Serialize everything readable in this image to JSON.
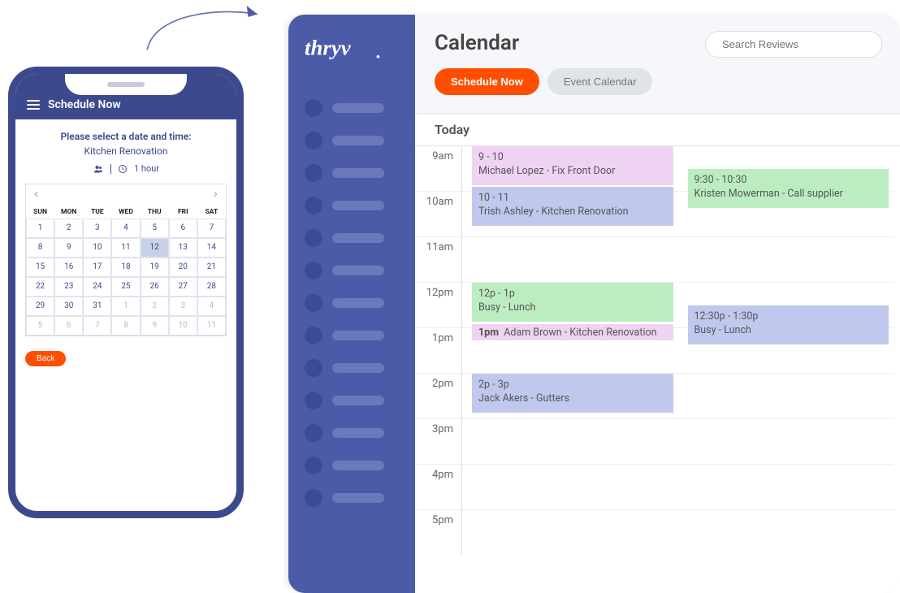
{
  "phone": {
    "header_title": "Schedule Now",
    "prompt_line1": "Please select a date and time:",
    "prompt_line2": "Kitchen Renovation",
    "duration_label": "1 hour",
    "day_headers": [
      "SUN",
      "MON",
      "TUE",
      "WED",
      "THU",
      "FRI",
      "SAT"
    ],
    "weeks": [
      [
        {
          "d": "1"
        },
        {
          "d": "2"
        },
        {
          "d": "3"
        },
        {
          "d": "4"
        },
        {
          "d": "5"
        },
        {
          "d": "6"
        },
        {
          "d": "7"
        }
      ],
      [
        {
          "d": "8"
        },
        {
          "d": "9"
        },
        {
          "d": "10"
        },
        {
          "d": "11"
        },
        {
          "d": "12",
          "sel": true
        },
        {
          "d": "13"
        },
        {
          "d": "14"
        }
      ],
      [
        {
          "d": "15"
        },
        {
          "d": "16"
        },
        {
          "d": "17"
        },
        {
          "d": "18"
        },
        {
          "d": "19"
        },
        {
          "d": "20"
        },
        {
          "d": "21"
        }
      ],
      [
        {
          "d": "22"
        },
        {
          "d": "23"
        },
        {
          "d": "24"
        },
        {
          "d": "25"
        },
        {
          "d": "26"
        },
        {
          "d": "27"
        },
        {
          "d": "28"
        }
      ],
      [
        {
          "d": "29"
        },
        {
          "d": "30"
        },
        {
          "d": "31"
        },
        {
          "d": "1",
          "out": true
        },
        {
          "d": "2",
          "out": true
        },
        {
          "d": "3",
          "out": true
        },
        {
          "d": "4",
          "out": true
        }
      ],
      [
        {
          "d": "5",
          "out": true
        },
        {
          "d": "6",
          "out": true
        },
        {
          "d": "7",
          "out": true
        },
        {
          "d": "8",
          "out": true
        },
        {
          "d": "9",
          "out": true
        },
        {
          "d": "10",
          "out": true
        },
        {
          "d": "11",
          "out": true
        }
      ]
    ],
    "back_label": "Back"
  },
  "desktop": {
    "logo_text": "thryv",
    "heading": "Calendar",
    "schedule_now_label": "Schedule Now",
    "event_calendar_label": "Event Calendar",
    "search_placeholder": "Search Reviews",
    "today_label": "Today",
    "hours": [
      "9am",
      "10am",
      "11am",
      "12pm",
      "1pm",
      "2pm",
      "3pm",
      "4pm",
      "5pm"
    ],
    "events": {
      "e1": {
        "time": "9 - 10",
        "desc": "Michael Lopez - Fix Front Door"
      },
      "e2": {
        "time": "10 - 11",
        "desc": "Trish Ashley - Kitchen Renovation"
      },
      "e3": {
        "time": "9:30 - 10:30",
        "desc": "Kristen Mowerman - Call supplier"
      },
      "e4": {
        "time": "12p - 1p",
        "desc": "Busy - Lunch"
      },
      "e5": {
        "time": "1pm",
        "desc": "Adam Brown - Kitchen Renovation"
      },
      "e6": {
        "time": "12:30p - 1:30p",
        "desc": "Busy - Lunch"
      },
      "e7": {
        "time": "2p - 3p",
        "desc": "Jack Akers - Gutters"
      }
    }
  }
}
